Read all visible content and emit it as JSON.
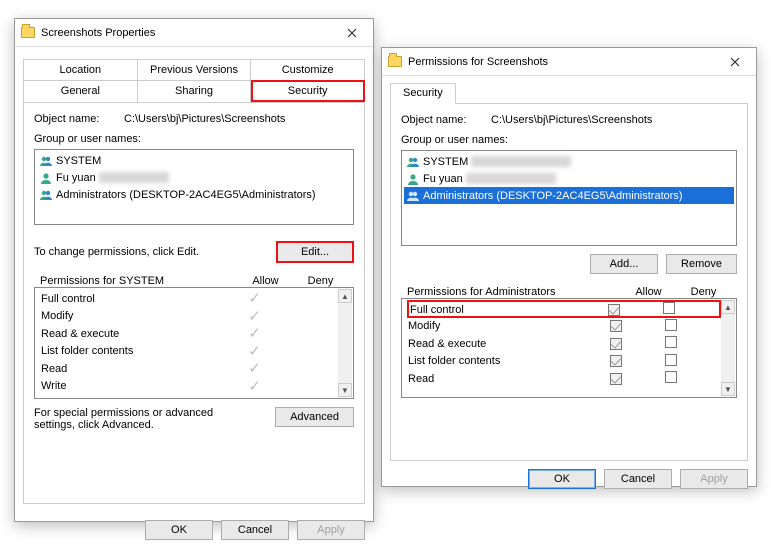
{
  "propsDialog": {
    "title": "Screenshots Properties",
    "tabsTop": {
      "location": "Location",
      "previous": "Previous Versions",
      "customize": "Customize"
    },
    "tabsBottom": {
      "general": "General",
      "sharing": "Sharing",
      "security": "Security"
    },
    "objectNameLabel": "Object name:",
    "objectPath": "C:\\Users\\bj\\Pictures\\Screenshots",
    "groupLabel": "Group or user names:",
    "users": {
      "system": "SYSTEM",
      "fuyuan": "Fu yuan",
      "admins": "Administrators (DESKTOP-2AC4EG5\\Administrators)"
    },
    "changeHint": "To change permissions, click Edit.",
    "editBtn": "Edit...",
    "permTitle": "Permissions for SYSTEM",
    "colAllow": "Allow",
    "colDeny": "Deny",
    "perms": {
      "full": "Full control",
      "modify": "Modify",
      "rx": "Read & execute",
      "list": "List folder contents",
      "read": "Read",
      "write": "Write"
    },
    "specialHint": "For special permissions or advanced settings, click Advanced.",
    "advancedBtn": "Advanced",
    "ok": "OK",
    "cancel": "Cancel",
    "apply": "Apply"
  },
  "permDialog": {
    "title": "Permissions for Screenshots",
    "tabLabel": "Security",
    "objectNameLabel": "Object name:",
    "objectPath": "C:\\Users\\bj\\Pictures\\Screenshots",
    "groupLabel": "Group or user names:",
    "users": {
      "system": "SYSTEM",
      "fuyuan": "Fu yuan",
      "admins": "Administrators (DESKTOP-2AC4EG5\\Administrators)"
    },
    "addBtn": "Add...",
    "removeBtn": "Remove",
    "permTitle": "Permissions for Administrators",
    "colAllow": "Allow",
    "colDeny": "Deny",
    "perms": {
      "full": "Full control",
      "modify": "Modify",
      "rx": "Read & execute",
      "list": "List folder contents",
      "read": "Read"
    },
    "ok": "OK",
    "cancel": "Cancel",
    "apply": "Apply"
  }
}
